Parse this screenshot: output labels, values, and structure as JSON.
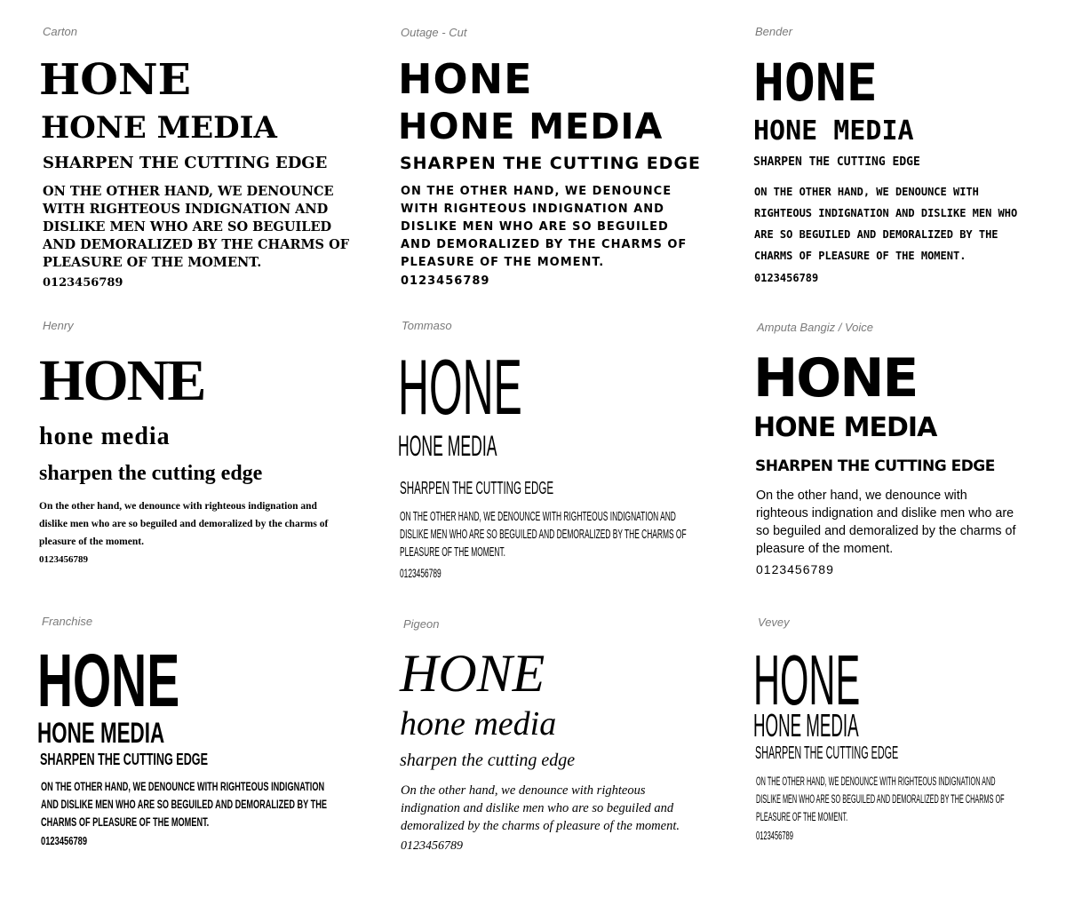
{
  "specimens": [
    {
      "font_name": "Carton",
      "display": "HONE",
      "brand": "HONE MEDIA",
      "tagline": "SHARPEN THE CUTTING EDGE",
      "paragraph": "ON THE OTHER HAND, WE DENOUNCE WITH RIGHTEOUS INDIGNATION AND DISLIKE MEN WHO ARE SO BEGUILED AND DEMORALIZED BY THE CHARMS OF PLEASURE OF THE MOMENT.",
      "digits": "0123456789"
    },
    {
      "font_name": "Outage - Cut",
      "display": "HONE",
      "brand": "HONE MEDIA",
      "tagline": "SHARPEN THE CUTTING EDGE",
      "paragraph": "ON THE OTHER HAND, WE DENOUNCE WITH RIGHTEOUS INDIGNATION AND DISLIKE MEN WHO ARE SO BEGUILED AND DEMORALIZED BY THE CHARMS OF PLEASURE OF THE MOMENT.",
      "digits": "0123456789"
    },
    {
      "font_name": "Bender",
      "display": "HONE",
      "brand": "HONE MEDIA",
      "tagline": "SHARPEN THE CUTTING EDGE",
      "paragraph": "ON THE OTHER HAND, WE DENOUNCE WITH RIGHTEOUS INDIGNATION AND DISLIKE MEN WHO ARE SO BEGUILED AND DEMORALIZED BY THE CHARMS OF PLEASURE OF THE MOMENT.",
      "digits": "0123456789"
    },
    {
      "font_name": "Henry",
      "display": "HONE",
      "brand": "hone media",
      "tagline": "sharpen the cutting edge",
      "paragraph": "On the other hand, we denounce with righteous indignation and dislike men who are so beguiled and demoralized by the charms of pleasure of the moment.",
      "digits": "0123456789"
    },
    {
      "font_name": "Tommaso",
      "display": "HONE",
      "brand": "HONE MEDIA",
      "tagline": "SHARPEN THE CUTTING EDGE",
      "paragraph": "ON THE OTHER HAND, WE DENOUNCE WITH RIGHTEOUS INDIGNATION AND DISLIKE MEN WHO ARE SO BEGUILED AND DEMORALIZED BY THE CHARMS OF PLEASURE OF THE MOMENT.",
      "digits": "0123456789"
    },
    {
      "font_name": "Amputa Bangiz / Voice",
      "display": "HONE",
      "brand": "HONE MEDIA",
      "tagline": "SHARPEN THE CUTTING EDGE",
      "paragraph": "On the other hand, we denounce with righteous indignation and dislike men who are so beguiled and demoralized by the charms of pleasure of the moment.",
      "digits": "0123456789"
    },
    {
      "font_name": "Franchise",
      "display": "HONE",
      "brand": "HONE MEDIA",
      "tagline": "SHARPEN THE CUTTING EDGE",
      "paragraph": "On the other hand, we denounce with righteous indignation and dislike men who are so beguiled and demoralized by the charms of pleasure of the moment.",
      "digits": "0123456789"
    },
    {
      "font_name": "Pigeon",
      "display": "HONE",
      "brand": "hone media",
      "tagline": "sharpen the cutting edge",
      "paragraph": "On the other hand, we denounce with righteous indignation and dislike men who are so beguiled and demoralized by the charms of pleasure of the moment.",
      "digits": "0123456789"
    },
    {
      "font_name": "Vevey",
      "display": "HONE",
      "brand": "HONE MEDIA",
      "tagline": "SHARPEN THE CUTTING EDGE",
      "paragraph": "ON THE OTHER HAND, WE DENOUNCE WITH RIGHTEOUS INDIGNATION AND DISLIKE MEN WHO ARE SO BEGUILED AND DEMORALIZED BY THE CHARMS OF PLEASURE OF THE MOMENT.",
      "digits": "0123456789"
    }
  ]
}
